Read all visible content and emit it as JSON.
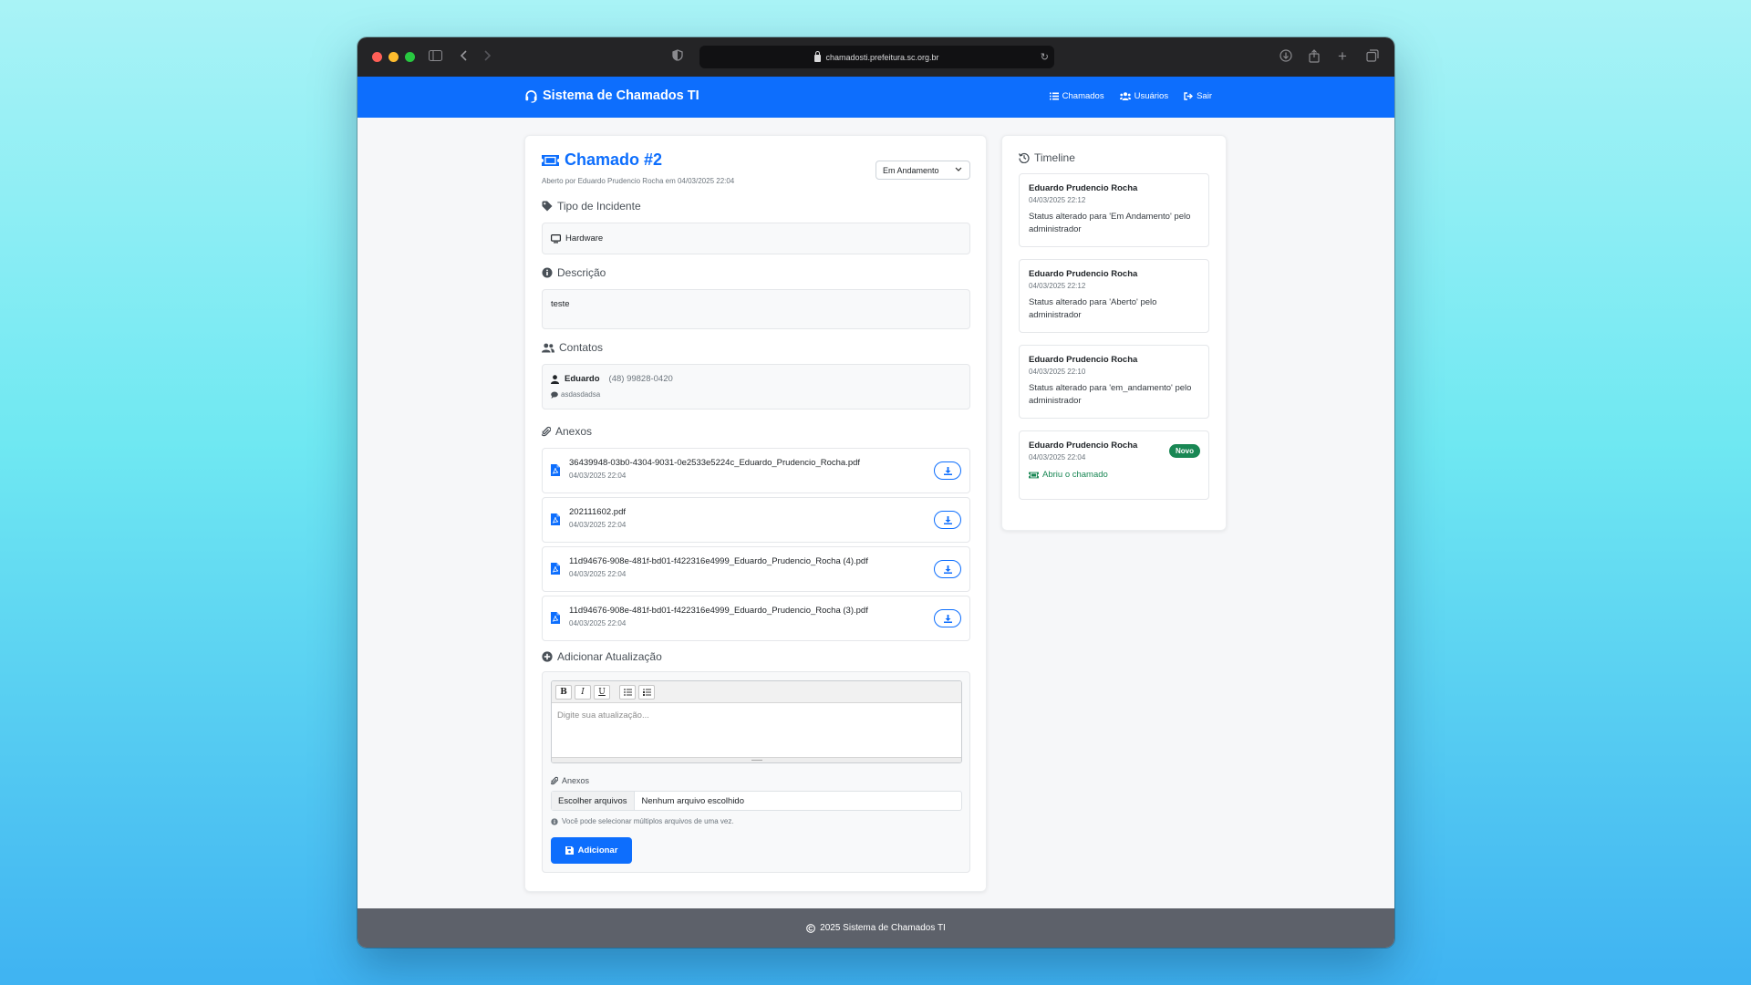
{
  "browser": {
    "url": "chamadosti.prefeitura.sc.org.br"
  },
  "navbar": {
    "brand": "Sistema de Chamados TI",
    "links": [
      {
        "label": "Chamados",
        "icon": "list-icon"
      },
      {
        "label": "Usuários",
        "icon": "users-icon"
      },
      {
        "label": "Sair",
        "icon": "logout-icon"
      }
    ]
  },
  "ticket": {
    "title": "Chamado #2",
    "subtitle": "Aberto por Eduardo Prudencio Rocha em 04/03/2025 22:04",
    "status": "Em Andamento",
    "incident_heading": "Tipo de Incidente",
    "incident_type": "Hardware",
    "description_heading": "Descrição",
    "description": "teste",
    "contacts_heading": "Contatos",
    "contact": {
      "name": "Eduardo",
      "phone": "(48) 99828-0420",
      "note": "asdasdadsa"
    },
    "attachments_heading": "Anexos",
    "attachments": [
      {
        "name": "36439948-03b0-4304-9031-0e2533e5224c_Eduardo_Prudencio_Rocha.pdf",
        "date": "04/03/2025 22:04"
      },
      {
        "name": "202111602.pdf",
        "date": "04/03/2025 22:04"
      },
      {
        "name": "11d94676-908e-481f-bd01-f422316e4999_Eduardo_Prudencio_Rocha (4).pdf",
        "date": "04/03/2025 22:04"
      },
      {
        "name": "11d94676-908e-481f-bd01-f422316e4999_Eduardo_Prudencio_Rocha (3).pdf",
        "date": "04/03/2025 22:04"
      }
    ]
  },
  "update_form": {
    "heading": "Adicionar Atualização",
    "toolbar": [
      "B",
      "I",
      "U"
    ],
    "placeholder": "Digite sua atualização...",
    "attachments_label": "Anexos",
    "choose_files": "Escolher arquivos",
    "no_file": "Nenhum arquivo escolhido",
    "hint": "Você pode selecionar múltiplos arquivos de uma vez.",
    "submit": "Adicionar"
  },
  "timeline": {
    "heading": "Timeline",
    "items": [
      {
        "author": "Eduardo Prudencio Rocha",
        "date": "04/03/2025 22:12",
        "message": "Status alterado para 'Em Andamento' pelo administrador"
      },
      {
        "author": "Eduardo Prudencio Rocha",
        "date": "04/03/2025 22:12",
        "message": "Status alterado para 'Aberto' pelo administrador"
      },
      {
        "author": "Eduardo Prudencio Rocha",
        "date": "04/03/2025 22:10",
        "message": "Status alterado para 'em_andamento' pelo administrador"
      },
      {
        "author": "Eduardo Prudencio Rocha",
        "date": "04/03/2025 22:04",
        "badge": "Novo",
        "message": "Abriu o chamado"
      }
    ]
  },
  "footer": {
    "text": "2025 Sistema de Chamados TI"
  },
  "colors": {
    "primary": "#0d6efd",
    "success": "#198754",
    "footer_bg": "#5d616a"
  }
}
